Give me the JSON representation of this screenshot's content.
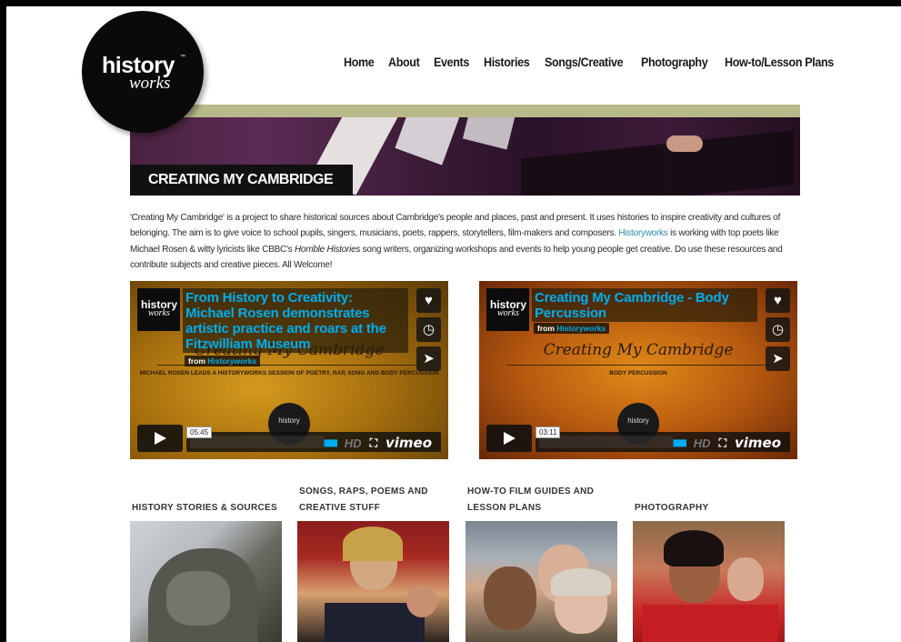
{
  "logo": {
    "line1": "history",
    "line2": "works",
    "tm": "™"
  },
  "nav": [
    "Home",
    "About",
    "Events",
    "Histories",
    "Songs/Creative",
    "Photography",
    "How-to/Lesson Plans"
  ],
  "banner": {
    "title": "CREATING MY CAMBRIDGE"
  },
  "intro": {
    "p1": "'Creating My Cambridge' is a project to share historical sources about Cambridge's people and places, past and present. It uses histories to inspire creativity and cultures of belonging. The aim is to give voice to school pupils, singers, musicians, poets, rappers, storytellers, film-makers and composers. ",
    "link": "Historyworks",
    "p2": " is working with top poets like Michael Rosen & witty lyricists like CBBC's ",
    "italic": "Horrible Histories",
    "p3": " song writers, organizing workshops and events to help young people get creative. Do use these resources and contribute subjects and creative pieces.  All Welcome!"
  },
  "videos": [
    {
      "title": "From History to Creativity: Michael Rosen demonstrates artistic practice and roars at the Fitzwilliam Museum",
      "from_prefix": "from",
      "from_by": "Historyworks",
      "bg_title": "Creating My Cambridge",
      "bg_subtitle": "MICHAEL ROSEN LEADS A HISTORYWORKS SESSION OF POETRY, RAP, SONG AND BODY PERCUSSION",
      "duration": "05:45",
      "logo_a": "history",
      "logo_b": "works",
      "center_logo": "history",
      "vimeo": "vimeo",
      "hd": "HD"
    },
    {
      "title": "Creating My Cambridge - Body Percussion",
      "from_prefix": "from",
      "from_by": "Historyworks",
      "bg_title": "Creating My Cambridge",
      "bg_subtitle": "BODY PERCUSSION",
      "duration": "03:11",
      "logo_a": "history",
      "logo_b": "works",
      "center_logo": "history",
      "vimeo": "vimeo",
      "hd": "HD"
    }
  ],
  "categories": [
    {
      "label_line1": "",
      "label_line2": "HISTORY STORIES & SOURCES"
    },
    {
      "label_line1": "SONGS, RAPS, POEMS AND",
      "label_line2": "CREATIVE STUFF"
    },
    {
      "label_line1": "HOW-TO FILM GUIDES AND",
      "label_line2": "LESSON PLANS"
    },
    {
      "label_line1": "",
      "label_line2": "PHOTOGRAPHY"
    }
  ],
  "colors": {
    "accent_link": "#2a8aa8",
    "vimeo_blue": "#00adef",
    "banner_strip": "#b8b98a"
  },
  "icons": {
    "like": "heart-icon",
    "later": "clock-icon",
    "share": "paper-plane-icon",
    "play": "play-icon",
    "fullscreen": "fullscreen-icon",
    "volume": "volume-icon"
  }
}
